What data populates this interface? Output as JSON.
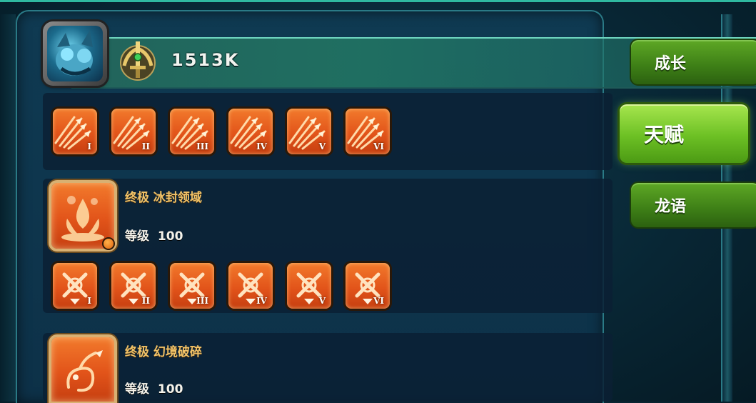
{
  "header": {
    "power_value": "1513K",
    "avatar_icon": "dragon-portrait-icon",
    "power_icon": "golden-sword-laurel-icon"
  },
  "tabs": [
    {
      "label": "成长",
      "active": false
    },
    {
      "label": "天赋",
      "active": true
    },
    {
      "label": "龙语",
      "active": false
    }
  ],
  "talent_rows": [
    {
      "icon": "arrow-volley-icon",
      "tiers": [
        "I",
        "II",
        "III",
        "IV",
        "V",
        "VI"
      ]
    },
    {
      "ultimate": {
        "prefix": "终极",
        "name": "冰封领域",
        "level_label": "等级",
        "level": "100",
        "icon": "flame-burst-icon"
      },
      "icon": "crossed-swords-icon",
      "tiers": [
        "I",
        "II",
        "III",
        "IV",
        "V",
        "VI"
      ]
    },
    {
      "ultimate": {
        "prefix": "终极",
        "name": "幻境破碎",
        "level_label": "等级",
        "level": "100",
        "icon": "dragon-emblem-icon"
      }
    }
  ],
  "colors": {
    "accent_teal": "#2fb9a0",
    "tab_green": "#5ea825",
    "tab_active": "#a7e64e",
    "skill_orange": "#e2541a",
    "ult_gold_text": "#f0c268"
  }
}
